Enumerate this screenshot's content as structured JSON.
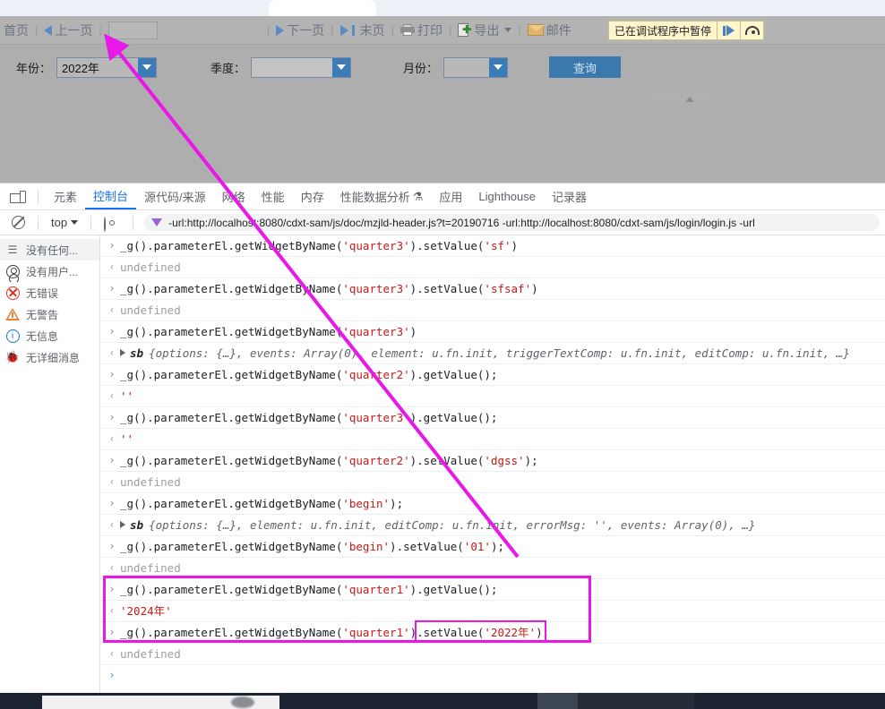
{
  "app": {
    "toolbar": {
      "home": "首页",
      "prev": "上一页",
      "page_value": "",
      "next": "下一页",
      "last": "末页",
      "print": "打印",
      "export": "导出",
      "mail": "邮件",
      "sep": "|"
    },
    "paused_banner": {
      "text": "已在调试程序中暂停",
      "resume_title": "恢复脚本执行",
      "step_title": "跳过下一个函数调用"
    },
    "filters": {
      "year_label": "年份：",
      "year_value": "2022年",
      "quarter_label": "季度：",
      "quarter_value": "",
      "month_label": "月份：",
      "month_value": "",
      "query_button": "查询"
    }
  },
  "devtools": {
    "tabs": [
      {
        "label": "元素",
        "active": false
      },
      {
        "label": "控制台",
        "active": true
      },
      {
        "label": "源代码/来源",
        "active": false
      },
      {
        "label": "网络",
        "active": false
      },
      {
        "label": "性能",
        "active": false
      },
      {
        "label": "内存",
        "active": false
      },
      {
        "label": "性能数据分析",
        "active": false,
        "suffix": "⚗"
      },
      {
        "label": "应用",
        "active": false
      },
      {
        "label": "Lighthouse",
        "active": false
      },
      {
        "label": "记录器",
        "active": false
      }
    ],
    "filterbar": {
      "context": "top",
      "filter_text": "-url:http://localhost:8080/cdxt-sam/js/doc/mzjld-header.js?t=20190716 -url:http://localhost:8080/cdxt-sam/js/login/login.js -url",
      "clear_title": "清除控制台",
      "eye_title": "创建实时表达式"
    },
    "sidebar": [
      {
        "icon": "list-icon",
        "label": "没有任何...",
        "selected": true
      },
      {
        "icon": "user-icon",
        "label": "没有用户...",
        "selected": false
      },
      {
        "icon": "error-icon",
        "label": "无错误",
        "selected": false
      },
      {
        "icon": "warning-icon",
        "label": "无警告",
        "selected": false
      },
      {
        "icon": "info-icon",
        "label": "无信息",
        "selected": false
      },
      {
        "icon": "bug-icon",
        "label": "无详细消息",
        "selected": false
      }
    ],
    "console_rows": [
      {
        "kind": "input",
        "parts": [
          {
            "t": "plain",
            "v": "_g().parameterEl.getWidgetByName("
          },
          {
            "t": "str",
            "v": "'quarter3'"
          },
          {
            "t": "plain",
            "v": ").setValue("
          },
          {
            "t": "str",
            "v": "'sf'"
          },
          {
            "t": "plain",
            "v": ")"
          }
        ]
      },
      {
        "kind": "output",
        "parts": [
          {
            "t": "undef",
            "v": "undefined"
          }
        ]
      },
      {
        "kind": "input",
        "parts": [
          {
            "t": "plain",
            "v": "_g().parameterEl.getWidgetByName("
          },
          {
            "t": "str",
            "v": "'quarter3'"
          },
          {
            "t": "plain",
            "v": ").setValue("
          },
          {
            "t": "str",
            "v": "'sfsaf'"
          },
          {
            "t": "plain",
            "v": ")"
          }
        ]
      },
      {
        "kind": "output",
        "parts": [
          {
            "t": "undef",
            "v": "undefined"
          }
        ]
      },
      {
        "kind": "input",
        "parts": [
          {
            "t": "plain",
            "v": "_g().parameterEl.getWidgetByName("
          },
          {
            "t": "str",
            "v": "'quarter3'"
          },
          {
            "t": "plain",
            "v": ")"
          }
        ]
      },
      {
        "kind": "object",
        "tag": "sb",
        "body": "{options: {…}, events: Array(0), element: u.fn.init, triggerTextComp: u.fn.init, editComp: u.fn.init,  …}"
      },
      {
        "kind": "input",
        "parts": [
          {
            "t": "plain",
            "v": "_g().parameterEl.getWidgetByName("
          },
          {
            "t": "str",
            "v": "'quarter2'"
          },
          {
            "t": "plain",
            "v": ").getValue();"
          }
        ]
      },
      {
        "kind": "output",
        "parts": [
          {
            "t": "str",
            "v": "''"
          }
        ]
      },
      {
        "kind": "input",
        "parts": [
          {
            "t": "plain",
            "v": "_g().parameterEl.getWidgetByName("
          },
          {
            "t": "str",
            "v": "'quarter3'"
          },
          {
            "t": "plain",
            "v": ").getValue();"
          }
        ]
      },
      {
        "kind": "output",
        "parts": [
          {
            "t": "str",
            "v": "''"
          }
        ]
      },
      {
        "kind": "input",
        "parts": [
          {
            "t": "plain",
            "v": "_g().parameterEl.getWidgetByName("
          },
          {
            "t": "str",
            "v": "'quarter2'"
          },
          {
            "t": "plain",
            "v": ").setValue("
          },
          {
            "t": "str",
            "v": "'dgss'"
          },
          {
            "t": "plain",
            "v": ");"
          }
        ]
      },
      {
        "kind": "output",
        "parts": [
          {
            "t": "undef",
            "v": "undefined"
          }
        ]
      },
      {
        "kind": "input",
        "parts": [
          {
            "t": "plain",
            "v": "_g().parameterEl.getWidgetByName("
          },
          {
            "t": "str",
            "v": "'begin'"
          },
          {
            "t": "plain",
            "v": ");"
          }
        ]
      },
      {
        "kind": "object",
        "tag": "sb",
        "body": "{options: {…}, element: u.fn.init, editComp: u.fn.init, errorMsg: '', events: Array(0),  …}"
      },
      {
        "kind": "input",
        "parts": [
          {
            "t": "plain",
            "v": "_g().parameterEl.getWidgetByName("
          },
          {
            "t": "str",
            "v": "'begin'"
          },
          {
            "t": "plain",
            "v": ").setValue("
          },
          {
            "t": "str",
            "v": "'01'"
          },
          {
            "t": "plain",
            "v": ");"
          }
        ]
      },
      {
        "kind": "output",
        "parts": [
          {
            "t": "undef",
            "v": "undefined"
          }
        ]
      },
      {
        "kind": "input",
        "parts": [
          {
            "t": "plain",
            "v": "_g().parameterEl.getWidgetByName("
          },
          {
            "t": "str",
            "v": "'quarter1'"
          },
          {
            "t": "plain",
            "v": ").getValue();"
          }
        ]
      },
      {
        "kind": "output",
        "parts": [
          {
            "t": "str",
            "v": "'2024年'"
          }
        ]
      },
      {
        "kind": "input",
        "parts": [
          {
            "t": "plain",
            "v": "_g().parameterEl.getWidgetByName("
          },
          {
            "t": "str",
            "v": "'quarter1'"
          },
          {
            "t": "plain",
            "v": ").setValue("
          },
          {
            "t": "str",
            "v": "'2022年'"
          },
          {
            "t": "plain",
            "v": ");"
          }
        ]
      },
      {
        "kind": "output",
        "parts": [
          {
            "t": "undef",
            "v": "undefined"
          }
        ]
      }
    ],
    "prompt": ""
  },
  "annotations": {
    "accent_color": "#e819e8",
    "arrow_label": "pointer-to-year-dropdown",
    "box_label": "highlight-quarter1-setvalue-block",
    "inner_box_label": "highlight-setvalue-2022"
  }
}
